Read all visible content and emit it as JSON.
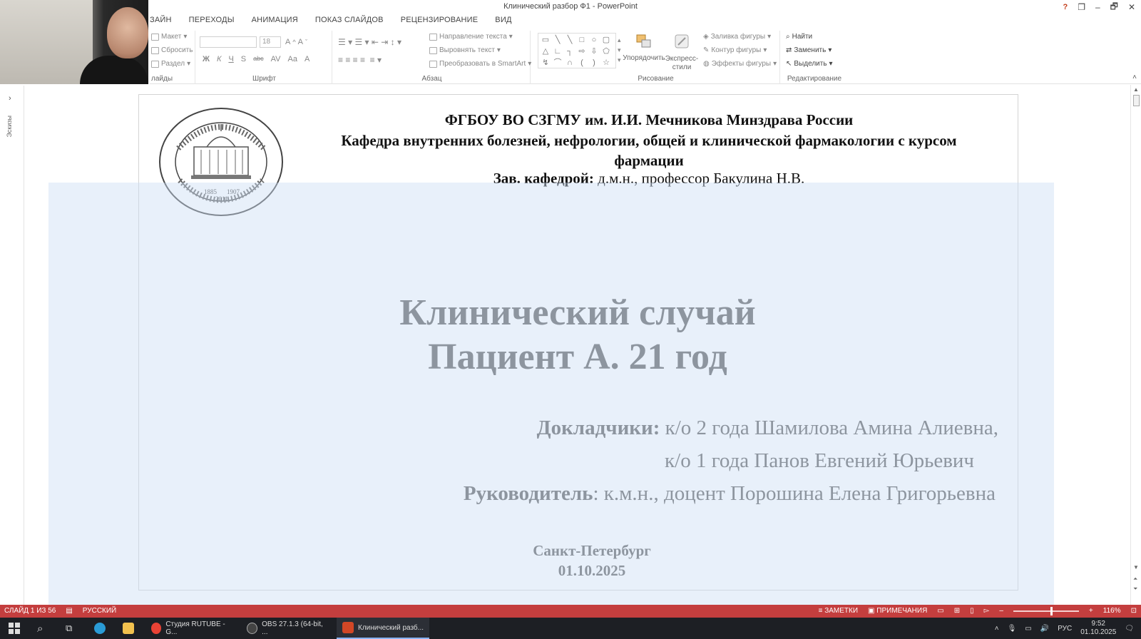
{
  "window": {
    "title": "Клинический разбор Ф1 - PowerPoint",
    "help": "?",
    "restore": "❐",
    "minimize": "–",
    "maximize": "🗗",
    "close": "✕"
  },
  "menu": {
    "tabs": [
      "ЗАЙН",
      "ПЕРЕХОДЫ",
      "АНИМАЦИЯ",
      "ПОКАЗ СЛАЙДОВ",
      "РЕЦЕНЗИРОВАНИЕ",
      "ВИД"
    ]
  },
  "ribbon": {
    "slides": {
      "layout": "Макет",
      "reset": "Сбросить",
      "section": "Раздел",
      "label": "лайды"
    },
    "font": {
      "size": "18",
      "label": "Шрифт",
      "bold": "Ж",
      "italic": "К",
      "underline": "Ч",
      "strike": "S",
      "abc": "abc",
      "spacing": "AV",
      "case": "Aa",
      "color": "A"
    },
    "paragraph": {
      "direction": "Направление текста",
      "align": "Выровнять текст",
      "smartart": "Преобразовать в SmartArt",
      "label": "Абзац"
    },
    "drawing": {
      "arrange": "Упорядочить",
      "quick_styles": "Экспресс-стили",
      "fill": "Заливка фигуры",
      "outline": "Контур фигуры",
      "effects": "Эффекты фигуры",
      "label": "Рисование"
    },
    "editing": {
      "find": "Найти",
      "replace": "Заменить",
      "select": "Выделить",
      "label": "Редактирование"
    }
  },
  "thumbs": {
    "label": "Эскизы"
  },
  "slide": {
    "logo_years": [
      "1885",
      "1907",
      "2011"
    ],
    "header_line1": "ФГБОУ ВО СЗГМУ им. И.И. Мечникова Минздрава России",
    "header_line2": "Кафедра внутренних болезней, нефрологии, общей и клинической фармакологии с курсом фармации",
    "head_label": "Зав. кафедрой:",
    "head_value": " д.м.н., профессор Бакулина Н.В.",
    "title_line1": "Клинический случай",
    "title_line2": "Пациент А. 21 год",
    "speakers_label": "Докладчики:",
    "speaker1": " к/о 2 года Шамилова Амина Алиевна,",
    "speaker2": "к/о 1 года Панов Евгений Юрьевич",
    "supervisor_label": "Руководитель",
    "supervisor_value": ": к.м.н., доцент Порошина Елена Григорьевна",
    "city": "Санкт-Петербург",
    "date": "01.10.2025"
  },
  "status": {
    "slide_counter": "СЛАЙД 1 ИЗ 56",
    "language": "РУССКИЙ",
    "notes": "ЗАМЕТКИ",
    "comments": "ПРИМЕЧАНИЯ",
    "zoom": "116%"
  },
  "taskbar": {
    "items": [
      "Студия RUTUBE - G...",
      "OBS 27.1.3 (64-bit, ...",
      "Клинический разб..."
    ],
    "lang": "РУС",
    "time": "9:52",
    "date": "01.10.2025"
  }
}
